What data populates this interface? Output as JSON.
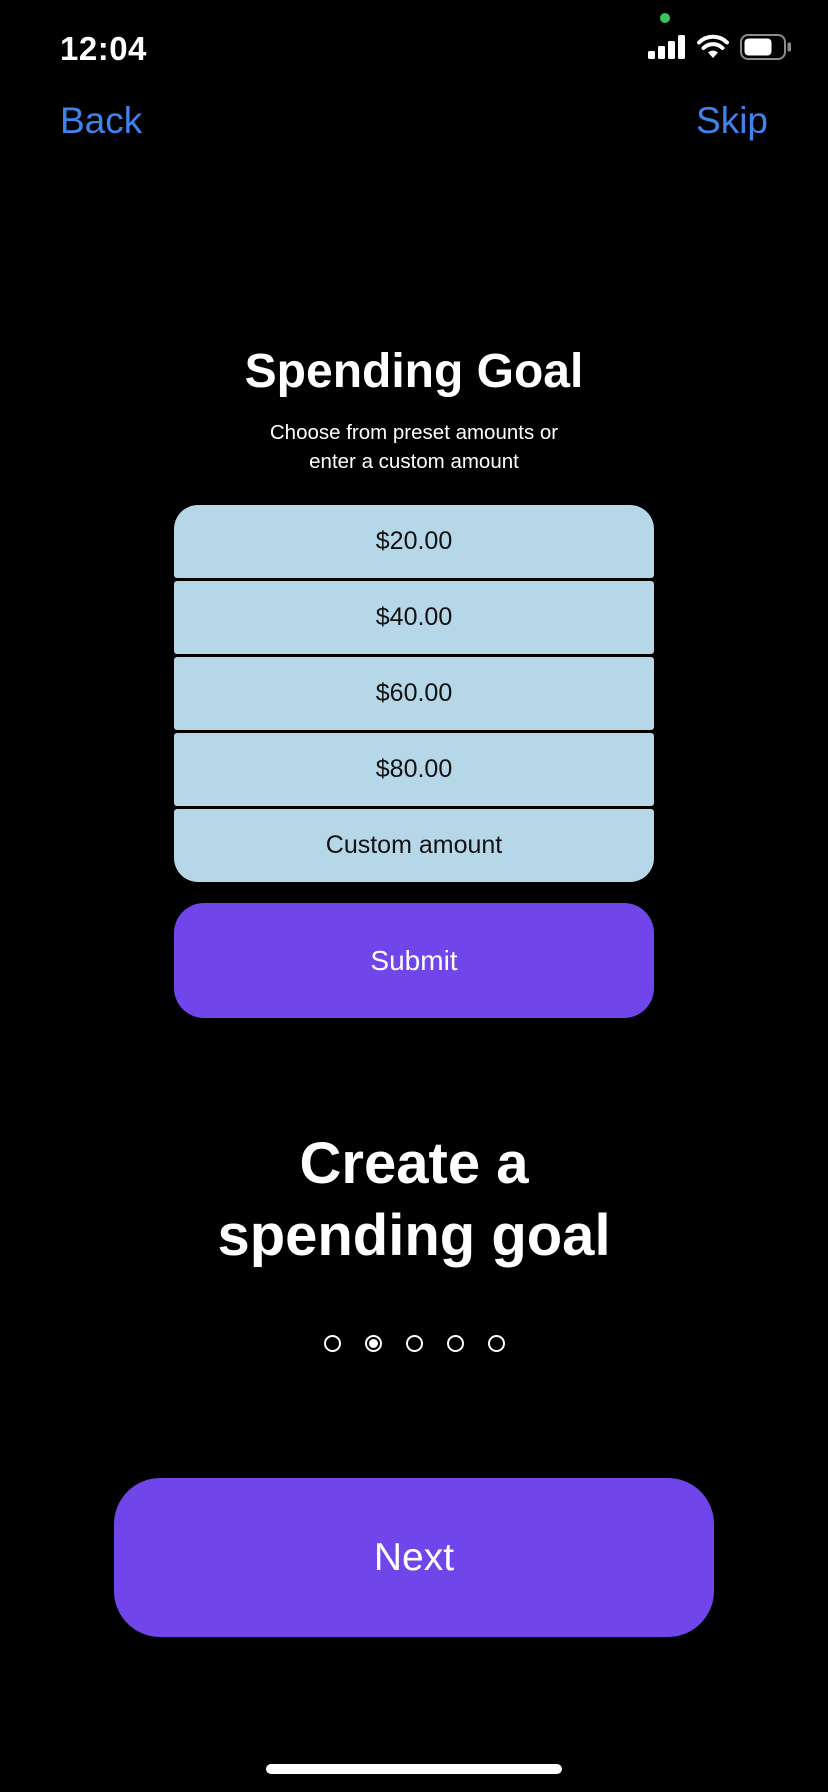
{
  "status_bar": {
    "time": "12:04",
    "icons": [
      "signal-icon",
      "wifi-icon",
      "battery-icon"
    ]
  },
  "nav": {
    "back_label": "Back",
    "skip_label": "Skip"
  },
  "goal": {
    "title": "Spending Goal",
    "subtitle_line1": "Choose from preset amounts or",
    "subtitle_line2": "enter a custom amount",
    "options": [
      "$20.00",
      "$40.00",
      "$60.00",
      "$80.00",
      "Custom amount"
    ],
    "submit_label": "Submit"
  },
  "onboarding": {
    "headline_line1": "Create a",
    "headline_line2": "spending goal",
    "page_count": 5,
    "current_page": 2,
    "next_label": "Next"
  },
  "colors": {
    "background": "#000000",
    "link_blue": "#3f83ee",
    "accent_purple": "#7045e9",
    "option_blue": "#b5d7e7",
    "camera_dot_green": "#35c759"
  }
}
